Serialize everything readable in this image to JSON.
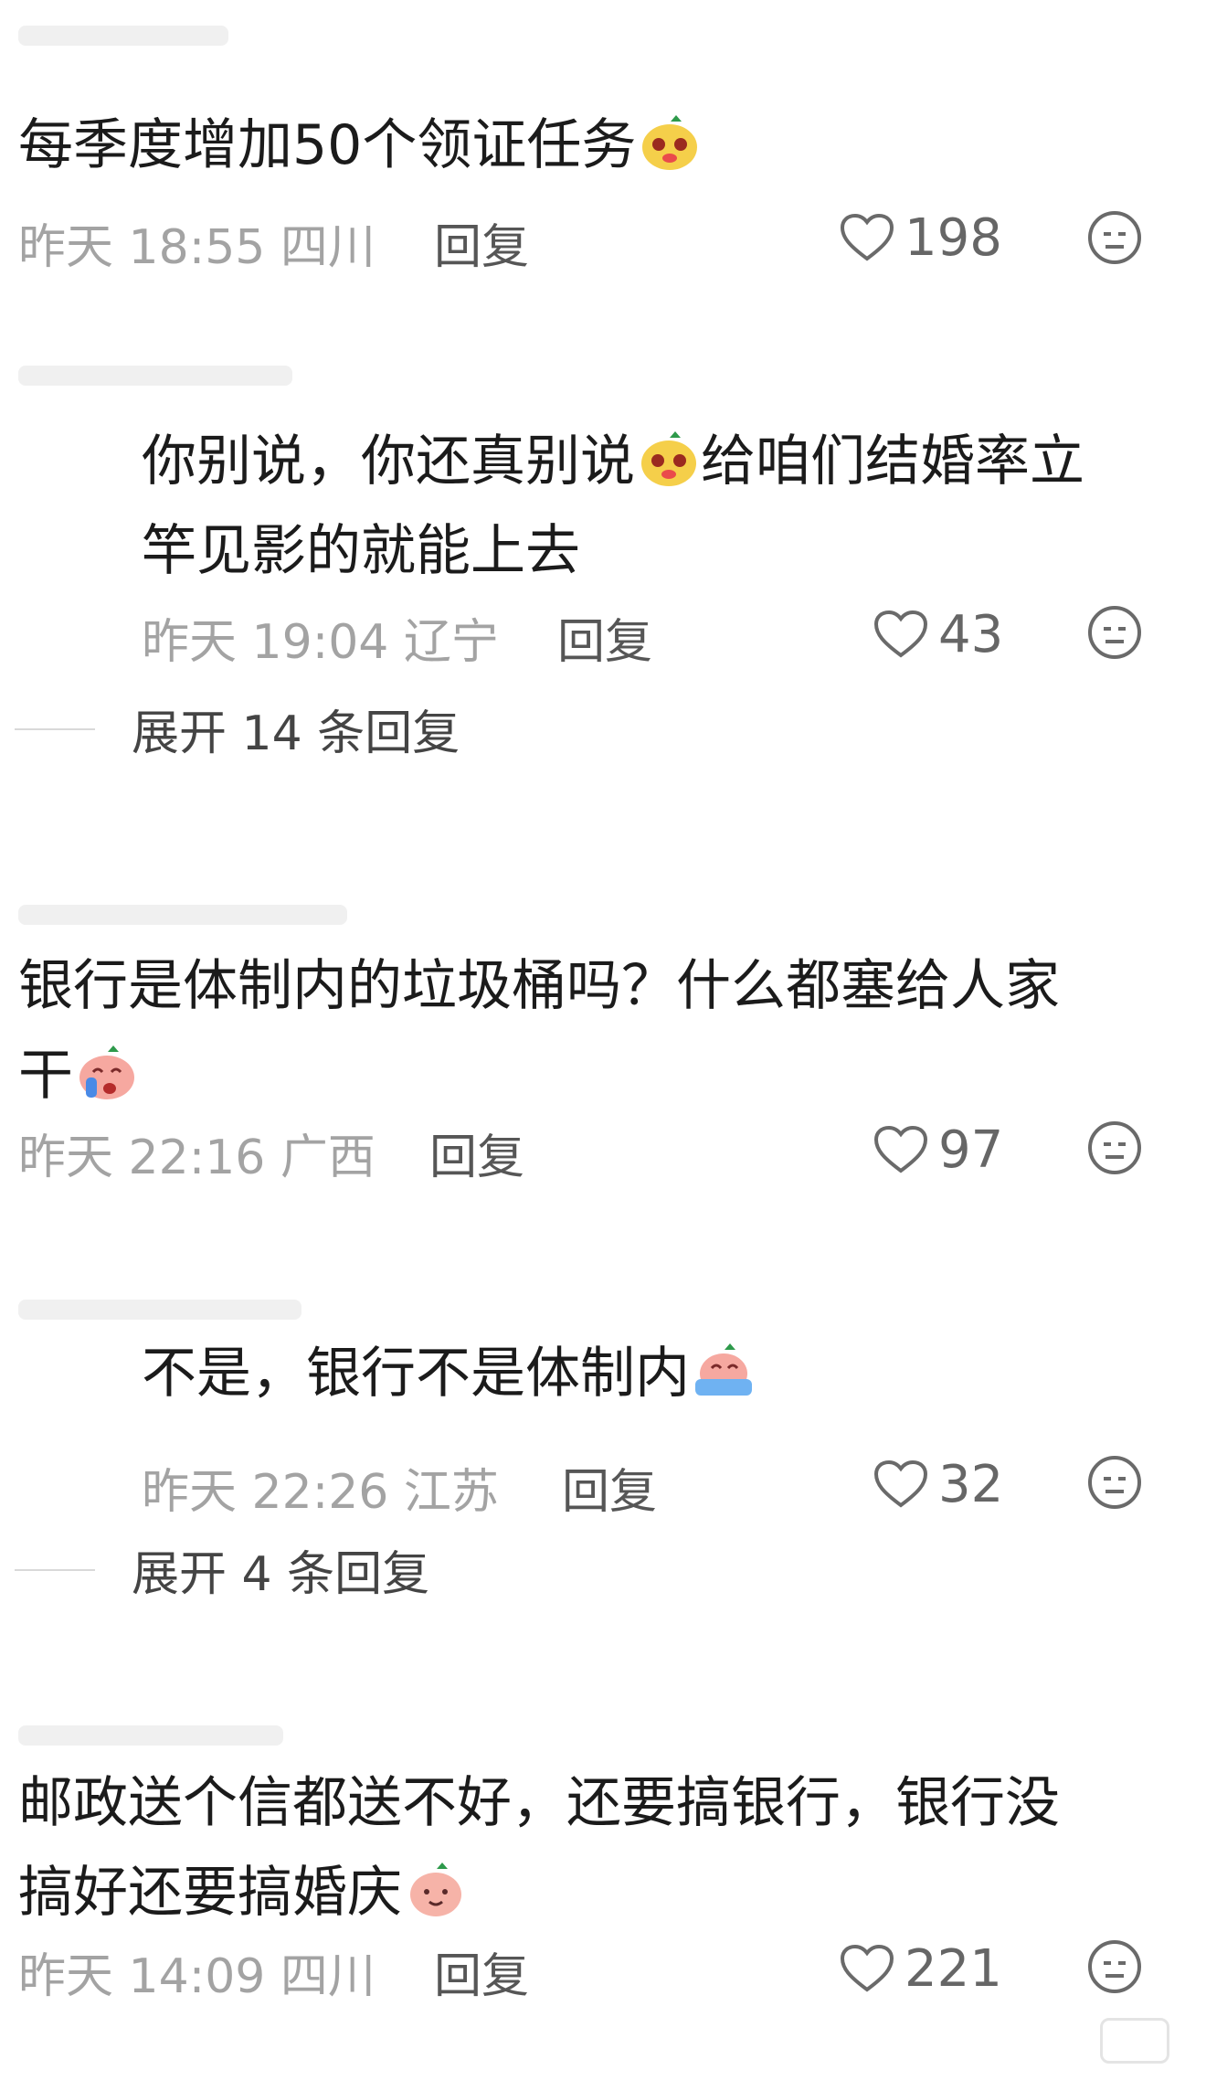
{
  "comments": [
    {
      "text": "每季度增加50个领证任务",
      "time": "昨天 18:55",
      "location": "四川",
      "reply_label": "回复",
      "likes": "198",
      "emoji": "pear-face-emoji"
    },
    {
      "text": "你别说，你还真别说",
      "text2": "给咱们结婚率立",
      "text3": "竿见影的就能上去",
      "time": "昨天 19:04",
      "location": "辽宁",
      "reply_label": "回复",
      "likes": "43",
      "emoji": "pear-face-emoji"
    },
    {
      "expand_label": "展开 14 条回复"
    },
    {
      "text": "银行是体制内的垃圾桶吗？什么都塞给人家",
      "text2": "干",
      "time": "昨天 22:16",
      "location": "广西",
      "reply_label": "回复",
      "likes": "97",
      "emoji": "crying-peach-emoji"
    },
    {
      "text": "不是，银行不是体制内",
      "time": "昨天 22:26",
      "location": "江苏",
      "reply_label": "回复",
      "likes": "32",
      "emoji": "tearful-peach-emoji"
    },
    {
      "expand_label": "展开 4 条回复"
    },
    {
      "text": "邮政送个信都送不好，还要搞银行，银行没",
      "text2": "搞好还要搞婚庆",
      "time": "昨天 14:09",
      "location": "四川",
      "reply_label": "回复",
      "likes": "221",
      "emoji": "peach-smile-emoji"
    }
  ]
}
